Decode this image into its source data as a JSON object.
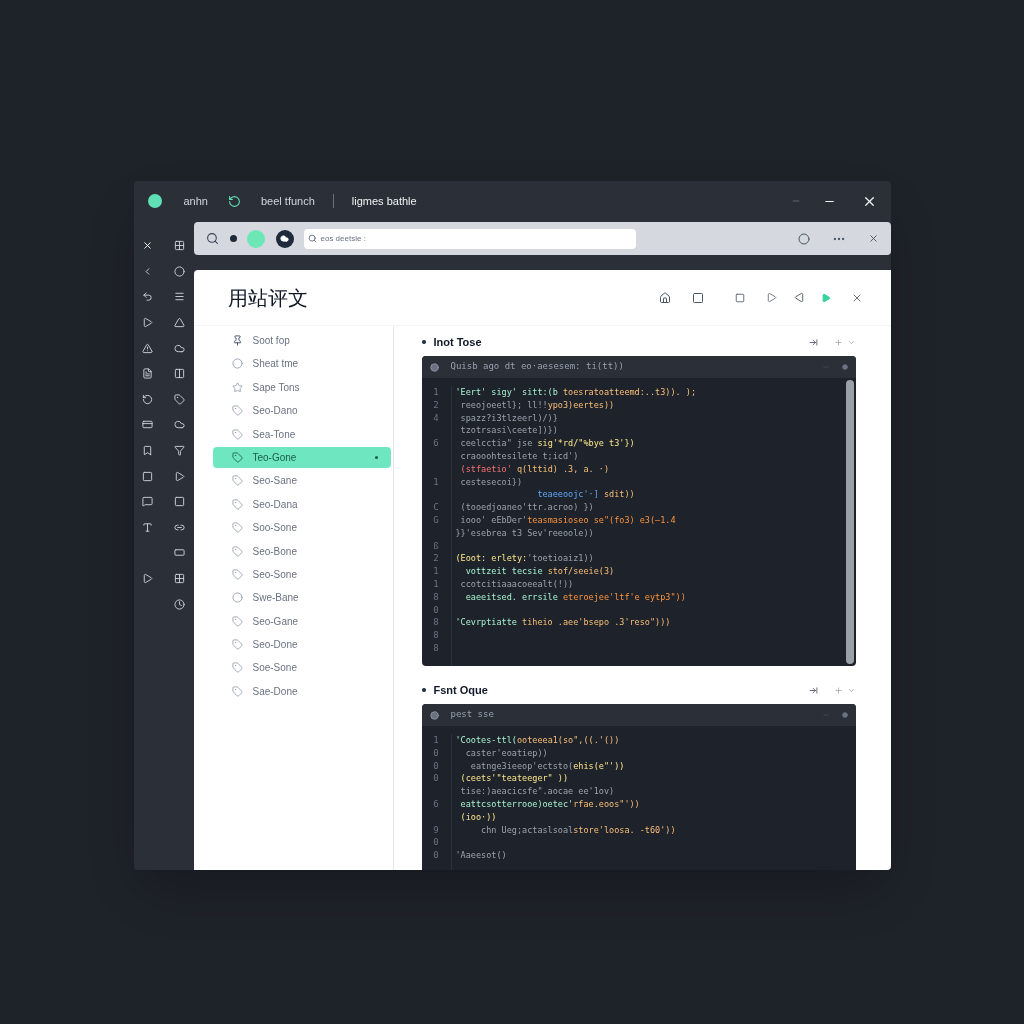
{
  "titlebar": {
    "items": [
      "anhn",
      "beel tfunch",
      "ligmes bathle"
    ]
  },
  "toolbar": {
    "search": {
      "value": "eos deetsie :"
    }
  },
  "page": {
    "heading": "用站评文"
  },
  "sidebar": {
    "items": [
      {
        "label": "Soot fop",
        "kind": "pin",
        "selected": false
      },
      {
        "label": "Sheat tme",
        "kind": "circle",
        "selected": false
      },
      {
        "label": "Sape Tons",
        "kind": "star",
        "selected": false
      },
      {
        "label": "Seo-Dano",
        "kind": "tag",
        "selected": false
      },
      {
        "label": "Sea-Tone",
        "kind": "tag",
        "selected": false
      },
      {
        "label": "Teo-Gone",
        "kind": "tag",
        "selected": true
      },
      {
        "label": "Seo-Sane",
        "kind": "tag",
        "selected": false
      },
      {
        "label": "Seo-Dana",
        "kind": "tag",
        "selected": false
      },
      {
        "label": "Soo-Sone",
        "kind": "tag",
        "selected": false
      },
      {
        "label": "Seo-Bone",
        "kind": "tag",
        "selected": false
      },
      {
        "label": "Seo-Sone",
        "kind": "tag",
        "selected": false
      },
      {
        "label": "Swe-Bane",
        "kind": "circle",
        "selected": false
      },
      {
        "label": "Seo-Gane",
        "kind": "tag",
        "selected": false
      },
      {
        "label": "Seo-Done",
        "kind": "tag",
        "selected": false
      },
      {
        "label": "Soe-Sone",
        "kind": "tag",
        "selected": false
      },
      {
        "label": "Sae-Done",
        "kind": "tag",
        "selected": false
      }
    ]
  },
  "sections": [
    {
      "title": "Inot Tose",
      "panel_title": "Quisb ago dt eo·aesesem: ti(tt))",
      "lines": [
        {
          "number": "1",
          "parts": [
            {
              "text": "'Eert' sigy' sitt:(b ",
              "kind": "name"
            },
            {
              "text": "toesratoatteemd:..t3)). );",
              "kind": "string"
            }
          ]
        },
        {
          "number": "2",
          "parts": [
            {
              "text": " reeojoeetl}; ll!!",
              "kind": "text"
            },
            {
              "text": "ypo3)eertes))",
              "kind": "string"
            }
          ]
        },
        {
          "number": "4",
          "parts": [
            {
              "text": " spazz?i3tlzeerl)/)}",
              "kind": "text"
            }
          ]
        },
        {
          "parts": [
            {
              "text": " tzotrsasi\\ceete])})",
              "kind": "text"
            }
          ]
        },
        {
          "number": "6",
          "parts": [
            {
              "text": " ceelcctia\" jse ",
              "kind": "text"
            },
            {
              "text": "sig'*rd/\"%bye t3'})",
              "kind": "key"
            }
          ]
        },
        {
          "parts": [
            {
              "text": " craooohtesilete t;icd')",
              "kind": "text"
            }
          ]
        },
        {
          "parts": [
            {
              "text": " (stfaetio' ",
              "kind": "error"
            },
            {
              "text": "q(lttid) .3, a. ·)",
              "kind": "string"
            }
          ]
        },
        {
          "number": "1",
          "parts": [
            {
              "text": " cestesecoi})",
              "kind": "text"
            }
          ]
        },
        {
          "parts": [
            {
              "text": "                teaeeoojc'·] ",
              "kind": "call"
            },
            {
              "text": "sdit))",
              "kind": "string"
            }
          ]
        },
        {
          "number": "C",
          "parts": [
            {
              "text": " (tooedjoaneo'ttr.acroo) })",
              "kind": "text"
            }
          ]
        },
        {
          "number": "G",
          "parts": [
            {
              "text": " iooo' eEbDer'",
              "kind": "text"
            },
            {
              "text": "teasmasioseo se\"(fo3) e3(—1.4",
              "kind": "number"
            }
          ]
        },
        {
          "parts": [
            {
              "text": "}}'esebrea t3 Sev'reeoole))",
              "kind": "text"
            }
          ]
        },
        {
          "number": "ß"
        },
        {
          "number": "2",
          "parts": [
            {
              "text": "(Eoot: erlety:",
              "kind": "key"
            },
            {
              "text": "'toetioaiz1))",
              "kind": "text"
            }
          ]
        },
        {
          "number": "1",
          "parts": [
            {
              "text": "  vottzeit tecsie ",
              "kind": "name"
            },
            {
              "text": "stof/seeie(3)",
              "kind": "string"
            }
          ]
        },
        {
          "number": "1",
          "parts": [
            {
              "text": " ccotcitiaaacoeealt(!))",
              "kind": "text"
            }
          ]
        },
        {
          "number": "8",
          "parts": [
            {
              "text": "  eaeeitsed. errsile ",
              "kind": "name"
            },
            {
              "text": "eteroejee'ltf'e eytp3\"))",
              "kind": "number"
            }
          ]
        },
        {
          "number": "0"
        },
        {
          "number": "8",
          "parts": [
            {
              "text": "'Cevrptiatte ",
              "kind": "name"
            },
            {
              "text": "tiheio .aee'bsepo .3'reso\")))",
              "kind": "string"
            }
          ]
        },
        {
          "number": "8"
        },
        {
          "number": "8"
        }
      ]
    },
    {
      "title": "Fsnt Oque",
      "panel_title": "pest sse",
      "lines": [
        {
          "number": "1",
          "parts": [
            {
              "text": "'Cootes-ttl(",
              "kind": "name"
            },
            {
              "text": "ooteeea1(so\",((.'())",
              "kind": "string"
            }
          ]
        },
        {
          "number": "0",
          "parts": [
            {
              "text": "  caster'eoatiep))",
              "kind": "text"
            }
          ]
        },
        {
          "number": "0",
          "parts": [
            {
              "text": "   eatnge3ieeop'ectsto(",
              "kind": "text"
            },
            {
              "text": "ehis(e\"'))",
              "kind": "key"
            }
          ]
        },
        {
          "number": "0",
          "parts": [
            {
              "text": " (ceets'\"teateeger\" ))",
              "kind": "key"
            }
          ]
        },
        {
          "parts": [
            {
              "text": " tise:)aeacicsfe\".aocae ee'1ov)",
              "kind": "text"
            }
          ]
        },
        {
          "number": "6",
          "parts": [
            {
              "text": " eattcsotterrooe)oetec'",
              "kind": "name"
            },
            {
              "text": "rfae.eoos\"'))",
              "kind": "string"
            }
          ]
        },
        {
          "parts": [
            {
              "text": " (ioo·))",
              "kind": "key"
            }
          ]
        },
        {
          "number": "9",
          "parts": [
            {
              "text": "     chn Ueg;actaslsoal",
              "kind": "text"
            },
            {
              "text": "store'loosa. ‑t60'))",
              "kind": "string"
            }
          ]
        },
        {
          "number": "0"
        },
        {
          "number": "0",
          "parts": [
            {
              "text": "'Aaeesot()",
              "kind": "text"
            }
          ]
        }
      ]
    }
  ]
}
